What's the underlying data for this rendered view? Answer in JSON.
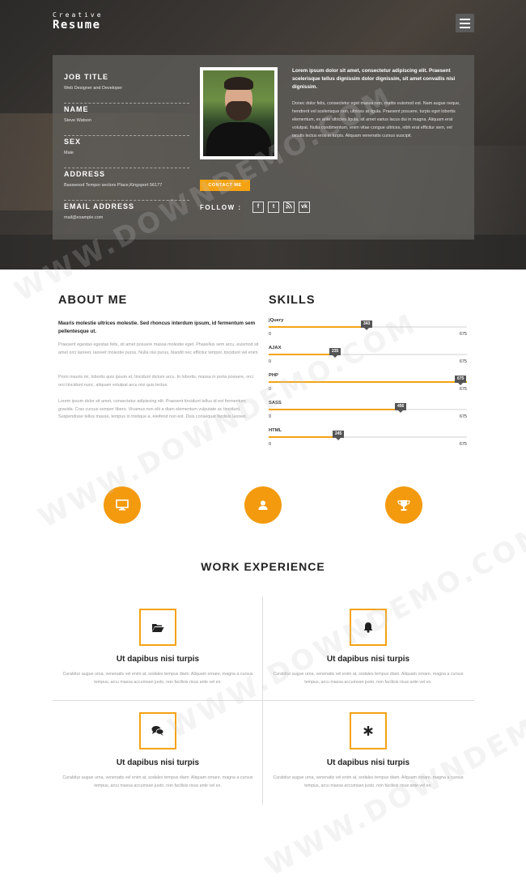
{
  "brand": {
    "small": "Creative",
    "big": "Resume"
  },
  "profile": {
    "items": [
      {
        "label": "JOB TITLE",
        "value": "Web Designer and Developer"
      },
      {
        "label": "NAME",
        "value": "Steve Watson"
      },
      {
        "label": "SEX",
        "value": "Male"
      },
      {
        "label": "ADDRESS",
        "value": "Basswood Tempor sectors Place,Kingsport 56177"
      },
      {
        "label": "EMAIL ADDRESS",
        "value": "mail@example.com"
      }
    ],
    "contact_label": "CONTACT ME",
    "follow_label": "FOLLOW :",
    "social": [
      "f",
      "t",
      "rss-icon",
      "vk"
    ],
    "lead": "Lorem ipsum dolor sit amet, consectetur adipiscing elit. Praesent scelerisque tellus dignissim dolor dignissim, sit amet convallis nisi dignissim.",
    "body": "Donec dolor felis, consectetur eget massa non, mattis euismod est. Nam augue neque, hendrerit vel scelerisque non, ultrices at ligula. Praesent posuere, turpis eget lobortis elementum, ex ante ultricies ligula, sit amet varius lacus dui in magna. Aliquam erat volutpat. Nulla condimentum, enim vitae congue ultrices, nibh erat efficitur sem, vel iaculis lectus eros in turpis. Aliquam venenatis cursus suscipit."
  },
  "about": {
    "title": "ABOUT ME",
    "lead": "Mauris molestie ultrices molestie. Sed rhoncus interdum ipsum, id fermentum sem pellentesque ut.",
    "paragraphs": [
      "Praesent egestas egestas felis, sit amet posuere massa molestie eget. Phasellus sem arcu, euismod sit amet orci laoreet, laoreet molestie purus. Nulla nisi purus, blandit nec efficitur tempor, tincidunt vel enim.",
      "Proin mauris mi, lobortis quis ipsum et, tincidunt dictum arcu. In lobortis, massa in porta posuere, orci orci tincidunt nunc, aliquam volutpat arcu nisi quis lectus.",
      "Lorem ipsum dolor sit amet, consectetur adipiscing elit. Praesent tincidunt tellus id est fermentum gravida. Cras cursus semper libero. Vivamus non elit a diam elementum vulputate ac tincidunt. Suspendisse tellus massa, tempus in tristique a, eleifend non est. Duis consequat facilisis laoreet."
    ]
  },
  "skills": {
    "title": "SKILLS",
    "items": [
      {
        "name": "jQuery",
        "value": 343,
        "min": 0,
        "max": 675
      },
      {
        "name": "AJAX",
        "value": 235,
        "min": 0,
        "max": 675
      },
      {
        "name": "PHP",
        "value": 675,
        "min": 0,
        "max": 675
      },
      {
        "name": "SASS",
        "value": 456,
        "min": 0,
        "max": 675
      },
      {
        "name": "HTML",
        "value": 245,
        "min": 0,
        "max": 675
      }
    ]
  },
  "icons": [
    "desktop-icon",
    "user-icon",
    "trophy-icon"
  ],
  "work": {
    "title": "WORK EXPERIENCE",
    "items": [
      {
        "icon": "folder-open-icon",
        "title": "Ut dapibus nisi turpis",
        "desc": "Curabitur augue urna, venenatis vel enim at, sodales tempus diam. Aliquam ornare, magna a cursus tempus, arcu massa accumsan justo, non facilisis risus ante vel ex."
      },
      {
        "icon": "bell-icon",
        "title": "Ut dapibus nisi turpis",
        "desc": "Curabitur augue urna, venenatis vel enim at, sodales tempus diam. Aliquam ornare, magna a cursus tempus, arcu massa accumsan justo, non facilisis risus ante vel ex."
      },
      {
        "icon": "comments-icon",
        "title": "Ut dapibus nisi turpis",
        "desc": "Curabitur augue urna, venenatis vel enim at, sodales tempus diam. Aliquam ornare, magna a cursus tempus, arcu massa accumsan justo, non facilisis risus ante vel ex."
      },
      {
        "icon": "asterisk-icon",
        "title": "Ut dapibus nisi turpis",
        "desc": "Curabitur augue urna, venenatis vel enim at, sodales tempus diam. Aliquam ornare, magna a cursus tempus, arcu massa accumsan justo, non facilisis risus ante vel ex."
      }
    ]
  },
  "watermark": "WWW.DOWNDEMO.COM",
  "colors": {
    "accent": "#f5a313",
    "circle": "#f39a0e",
    "dark": "#222222"
  }
}
